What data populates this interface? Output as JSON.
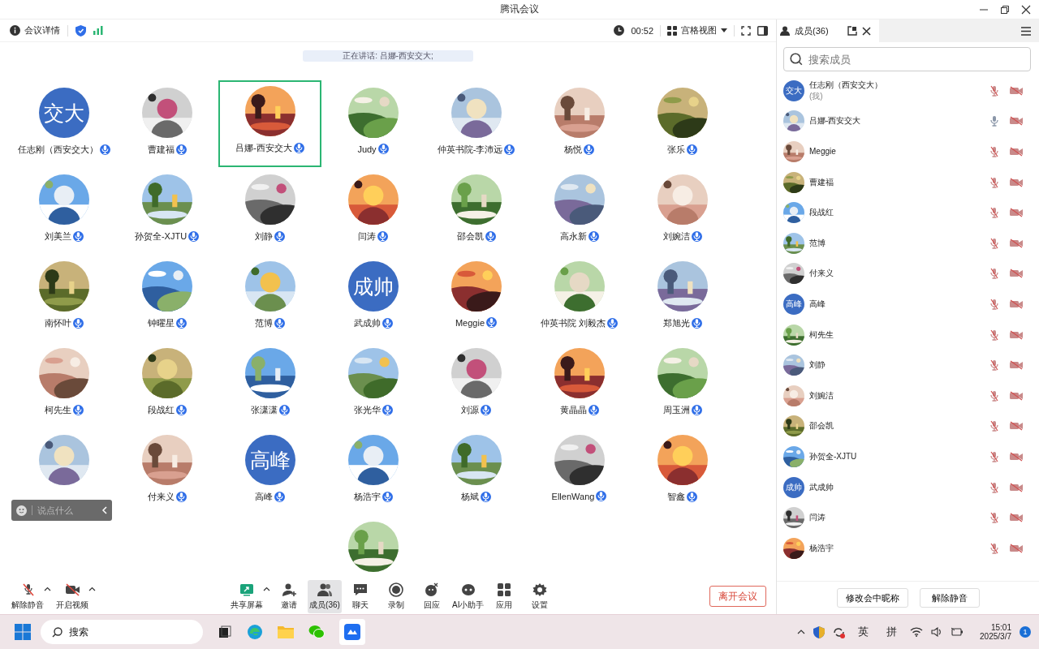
{
  "window": {
    "title": "腾讯会议"
  },
  "top_bar": {
    "details": "会议详情",
    "timer": "00:52",
    "view": "宫格视图"
  },
  "speaking_banner": "正在讲话: 吕娜-西安交大;",
  "tiles": [
    {
      "name": "任志刚（西安交大）",
      "avatar": {
        "kind": "text",
        "text": "交大"
      },
      "speaking": false
    },
    {
      "name": "曹建福",
      "speaking": false
    },
    {
      "name": "吕娜-西安交大",
      "speaking": true
    },
    {
      "name": "Judy",
      "speaking": false
    },
    {
      "name": "仲英书院-李沛远",
      "speaking": false
    },
    {
      "name": "杨悦",
      "speaking": false
    },
    {
      "name": "张乐",
      "speaking": false
    },
    {
      "name": "刘美兰",
      "speaking": false
    },
    {
      "name": "孙贺全-XJTU",
      "speaking": false
    },
    {
      "name": "刘静",
      "speaking": false
    },
    {
      "name": "闫涛",
      "speaking": false
    },
    {
      "name": "邵会凯",
      "speaking": false
    },
    {
      "name": "高永新",
      "speaking": false
    },
    {
      "name": "刘婉洁",
      "speaking": false
    },
    {
      "name": "南怀叶",
      "speaking": false
    },
    {
      "name": "钟曜星",
      "speaking": false
    },
    {
      "name": "范博",
      "speaking": false
    },
    {
      "name": "武成帅",
      "avatar": {
        "kind": "text",
        "text": "成帅"
      },
      "speaking": false
    },
    {
      "name": "Meggie",
      "speaking": false
    },
    {
      "name": "仲英书院 刘毅杰",
      "speaking": false
    },
    {
      "name": "郑旭光",
      "speaking": false
    },
    {
      "name": "柯先生",
      "speaking": false
    },
    {
      "name": "段战红",
      "speaking": false
    },
    {
      "name": "张潇潇",
      "speaking": false
    },
    {
      "name": "张光华",
      "speaking": false
    },
    {
      "name": "刘源",
      "speaking": false
    },
    {
      "name": "黄晶晶",
      "speaking": false
    },
    {
      "name": "周玉洲",
      "speaking": false
    },
    {
      "speaking": false
    },
    {
      "name": "付来义",
      "speaking": false
    },
    {
      "name": "高峰",
      "avatar": {
        "kind": "text",
        "text": "高峰"
      },
      "speaking": false
    },
    {
      "name": "杨浩宇",
      "speaking": false
    },
    {
      "name": "杨斌",
      "speaking": false
    },
    {
      "name": "EllenWang",
      "speaking": false
    },
    {
      "name": "智鑫",
      "speaking": false
    },
    {
      "speaking": false
    }
  ],
  "chat_bubble": {
    "placeholder": "说点什么"
  },
  "toolbar": [
    {
      "kind": "mic",
      "label": "解除静音",
      "off": true,
      "menu": true,
      "selected": false
    },
    {
      "kind": "camera",
      "label": "开启视频",
      "off": true,
      "menu": true,
      "selected": false
    },
    {
      "kind": "share",
      "label": "共享屏幕",
      "menu": true,
      "selected": false
    },
    {
      "kind": "invite",
      "label": "邀请",
      "menu": false,
      "selected": false
    },
    {
      "kind": "members",
      "label": "成员(36)",
      "menu": false,
      "selected": true
    },
    {
      "kind": "chat",
      "label": "聊天",
      "menu": false,
      "selected": false
    },
    {
      "kind": "record",
      "label": "录制",
      "menu": false,
      "selected": false
    },
    {
      "kind": "reaction",
      "label": "回应",
      "menu": false,
      "selected": false
    },
    {
      "kind": "assistant",
      "label": "AI小助手",
      "menu": false,
      "selected": false
    },
    {
      "kind": "apps",
      "label": "应用",
      "menu": false,
      "selected": false
    },
    {
      "kind": "settings",
      "label": "设置",
      "menu": false,
      "selected": false
    }
  ],
  "leave_button": "离开会议",
  "members_panel": {
    "title": "成员(36)",
    "search_placeholder": "搜索成员",
    "members": [
      {
        "name": "任志刚（西安交大）",
        "note": "(我)",
        "avatar": {
          "kind": "text",
          "text": "交大"
        },
        "mic_muted": true,
        "camera_off": true
      },
      {
        "name": "吕娜-西安交大",
        "mic_muted": false,
        "camera_off": true
      },
      {
        "name": "Meggie",
        "mic_muted": true,
        "camera_off": true
      },
      {
        "name": "曹建福",
        "mic_muted": true,
        "camera_off": true
      },
      {
        "name": "段战红",
        "mic_muted": true,
        "camera_off": true
      },
      {
        "name": "范博",
        "mic_muted": true,
        "camera_off": true
      },
      {
        "name": "付来义",
        "mic_muted": true,
        "camera_off": true
      },
      {
        "name": "高峰",
        "avatar": {
          "kind": "text",
          "text": "高峰"
        },
        "mic_muted": true,
        "camera_off": true
      },
      {
        "name": "柯先生",
        "mic_muted": true,
        "camera_off": true
      },
      {
        "name": "刘静",
        "mic_muted": true,
        "camera_off": true
      },
      {
        "name": "刘婉洁",
        "mic_muted": true,
        "camera_off": true
      },
      {
        "name": "邵会凯",
        "mic_muted": true,
        "camera_off": true
      },
      {
        "name": "孙贺全-XJTU",
        "mic_muted": true,
        "camera_off": true
      },
      {
        "name": "武成帅",
        "avatar": {
          "kind": "text",
          "text": "成帅"
        },
        "mic_muted": true,
        "camera_off": true
      },
      {
        "name": "闫涛",
        "mic_muted": true,
        "camera_off": true
      },
      {
        "name": "杨浩宇",
        "mic_muted": true,
        "camera_off": true
      }
    ],
    "buttons": [
      "修改会中昵称",
      "解除静音"
    ]
  },
  "taskbar": {
    "search": "搜索",
    "ime": [
      "英",
      "拼"
    ],
    "time": "15:01",
    "date": "2025/3/7",
    "notifications": "1"
  }
}
